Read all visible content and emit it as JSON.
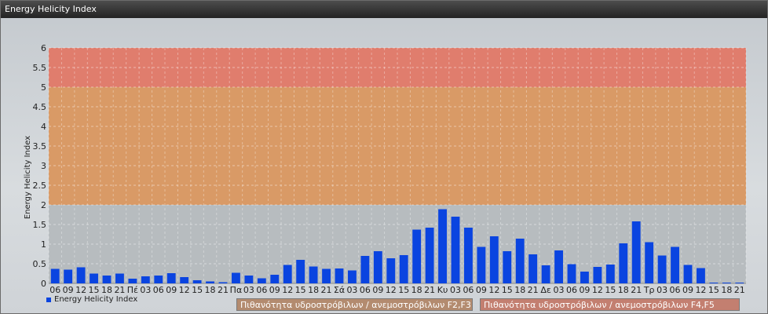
{
  "window": {
    "title": "Energy Helicity Index"
  },
  "legend": {
    "label": "Energy Helicity Index"
  },
  "risk_labels": [
    "Πιθανότητα υδροστρόβιλων / ανεμοστρόβιλων F2,F3",
    "Πιθανότητα υδροστρόβιλων / ανεμοστρόβιλων F4,F5"
  ],
  "colors": {
    "bar": "#0a44e0",
    "band_low": "#b7bcbf",
    "band_mid": "#d99a66",
    "band_high": "#e07d6d"
  },
  "chart_data": {
    "type": "bar",
    "title": "",
    "xlabel": "",
    "ylabel": "Energy Helicity Index",
    "ylim": [
      0,
      6
    ],
    "yticks": [
      "0",
      "0.5",
      "1",
      "1.5",
      "2",
      "2.5",
      "3",
      "3.5",
      "4",
      "4.5",
      "5",
      "5.5",
      "6"
    ],
    "grid": true,
    "legend_position": "bottom-left",
    "bands": [
      {
        "from": 0,
        "to": 2,
        "color": "#b7bcbf"
      },
      {
        "from": 2,
        "to": 5,
        "color": "#d99a66"
      },
      {
        "from": 5,
        "to": 6,
        "color": "#e07d6d"
      }
    ],
    "categories": [
      "06",
      "09",
      "12",
      "15",
      "18",
      "21",
      "Πέ",
      "03",
      "06",
      "09",
      "12",
      "15",
      "18",
      "21",
      "Πα",
      "03",
      "06",
      "09",
      "12",
      "15",
      "18",
      "21",
      "Σά",
      "03",
      "06",
      "09",
      "12",
      "15",
      "18",
      "21",
      "Κυ",
      "03",
      "06",
      "09",
      "12",
      "15",
      "18",
      "21",
      "Δε",
      "03",
      "06",
      "09",
      "12",
      "15",
      "18",
      "21",
      "Τρ",
      "03",
      "06",
      "09",
      "12",
      "15",
      "18",
      "21"
    ],
    "series": [
      {
        "name": "Energy Helicity Index",
        "values": [
          0.37,
          0.35,
          0.41,
          0.25,
          0.2,
          0.25,
          0.12,
          0.18,
          0.2,
          0.26,
          0.16,
          0.08,
          0.05,
          0.03,
          0.27,
          0.2,
          0.13,
          0.22,
          0.47,
          0.6,
          0.43,
          0.37,
          0.38,
          0.33,
          0.7,
          0.82,
          0.64,
          0.72,
          1.37,
          1.42,
          1.89,
          1.7,
          1.42,
          0.93,
          1.2,
          0.82,
          1.14,
          0.74,
          0.46,
          0.84,
          0.49,
          0.3,
          0.42,
          0.48,
          1.02,
          1.58,
          1.05,
          0.71,
          0.93,
          0.47,
          0.39,
          0.02,
          0.02,
          0.02
        ]
      }
    ]
  }
}
